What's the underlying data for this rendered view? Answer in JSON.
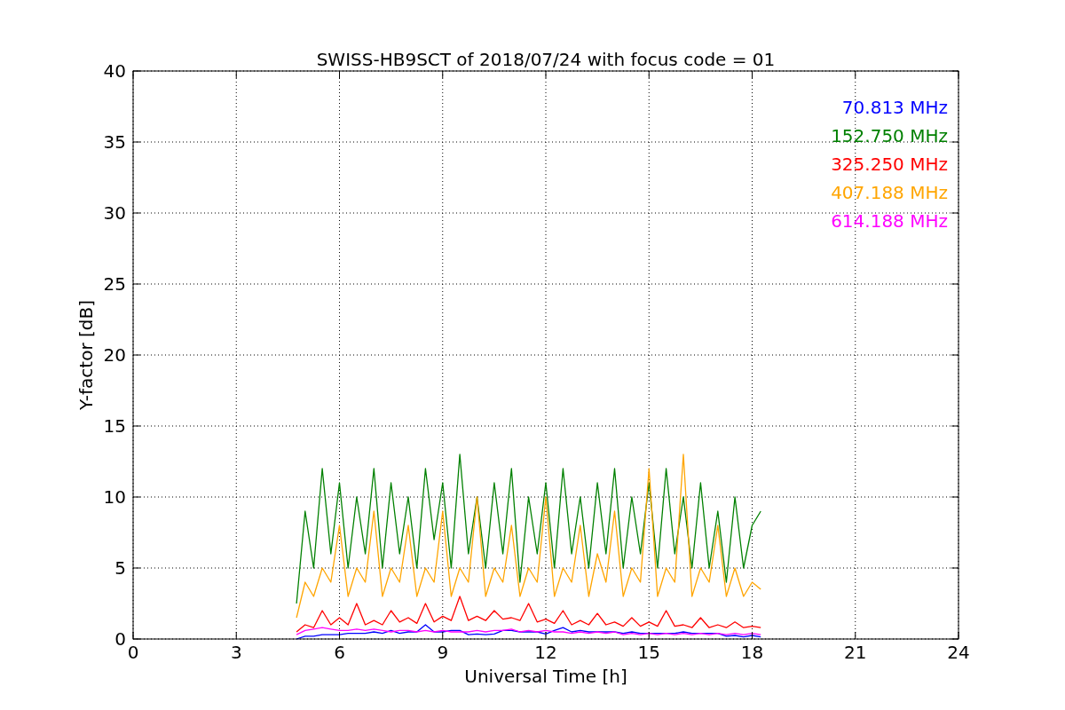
{
  "figure": {
    "chart_data": {
      "type": "line",
      "title": "SWISS-HB9SCT of 2018/07/24 with focus code = 01",
      "xlabel": "Universal Time [h]",
      "ylabel": "Y-factor [dB]",
      "xlim": [
        0,
        24
      ],
      "ylim": [
        0,
        40
      ],
      "grid": true,
      "xticks": [
        0,
        3,
        6,
        9,
        12,
        15,
        18,
        21,
        24
      ],
      "yticks": [
        0,
        5,
        10,
        15,
        20,
        25,
        30,
        35,
        40
      ],
      "x": [
        4.75,
        5,
        5.25,
        5.5,
        5.75,
        6,
        6.25,
        6.5,
        6.75,
        7,
        7.25,
        7.5,
        7.75,
        8,
        8.25,
        8.5,
        8.75,
        9,
        9.25,
        9.5,
        9.75,
        10,
        10.25,
        10.5,
        10.75,
        11,
        11.25,
        11.5,
        11.75,
        12,
        12.25,
        12.5,
        12.75,
        13,
        13.25,
        13.5,
        13.75,
        14,
        14.25,
        14.5,
        14.75,
        15,
        15.25,
        15.5,
        15.75,
        16,
        16.25,
        16.5,
        16.75,
        17,
        17.25,
        17.5,
        17.75,
        18,
        18.25
      ],
      "series": [
        {
          "name": "70.813 MHz",
          "color": "#0000ff",
          "values": [
            0,
            0.2,
            0.2,
            0.3,
            0.3,
            0.3,
            0.4,
            0.4,
            0.4,
            0.5,
            0.4,
            0.6,
            0.4,
            0.5,
            0.5,
            1,
            0.5,
            0.5,
            0.6,
            0.6,
            0.3,
            0.35,
            0.3,
            0.35,
            0.6,
            0.6,
            0.5,
            0.5,
            0.5,
            0.35,
            0.6,
            0.8,
            0.5,
            0.6,
            0.5,
            0.5,
            0.5,
            0.5,
            0.4,
            0.5,
            0.4,
            0.4,
            0.4,
            0.4,
            0.4,
            0.5,
            0.4,
            0.4,
            0.4,
            0.4,
            0.2,
            0.25,
            0.15,
            0.25,
            0.15
          ]
        },
        {
          "name": "152.750 MHz",
          "color": "#008000",
          "values": [
            2.5,
            9,
            5,
            12,
            6,
            11,
            5,
            10,
            6,
            12,
            5,
            11,
            6,
            10,
            5,
            12,
            7,
            11,
            5,
            13,
            6,
            10,
            5,
            11,
            6,
            12,
            4,
            10,
            6,
            11,
            5,
            12,
            6,
            10,
            5,
            11,
            6,
            12,
            5,
            10,
            6,
            11,
            5,
            12,
            6,
            10,
            5,
            11,
            5,
            9,
            4,
            10,
            5,
            8,
            9
          ]
        },
        {
          "name": "325.250 MHz",
          "color": "#ff0000",
          "values": [
            0.5,
            1,
            0.8,
            2,
            1,
            1.5,
            1,
            2.5,
            1,
            1.3,
            1,
            2,
            1.2,
            1.5,
            1.1,
            2.5,
            1.2,
            1.6,
            1.3,
            3,
            1.3,
            1.6,
            1.3,
            2,
            1.4,
            1.5,
            1.3,
            2.5,
            1.2,
            1.4,
            1.1,
            2,
            1,
            1.3,
            1,
            1.8,
            1,
            1.2,
            0.9,
            1.5,
            0.9,
            1.2,
            0.9,
            2,
            0.9,
            1,
            0.8,
            1.5,
            0.8,
            1,
            0.8,
            1.2,
            0.8,
            0.9,
            0.8
          ]
        },
        {
          "name": "407.188 MHz",
          "color": "#ffa500",
          "values": [
            1.5,
            4,
            3,
            5,
            4,
            8,
            3,
            5,
            4,
            9,
            3,
            5,
            4,
            8,
            3,
            5,
            4,
            9,
            3,
            5,
            4,
            10,
            3,
            5,
            4,
            8,
            3,
            5,
            4,
            10,
            3,
            5,
            4,
            8,
            3,
            6,
            4,
            9,
            3,
            5,
            4,
            12,
            3,
            5,
            4,
            13,
            3,
            5,
            4,
            8,
            3,
            5,
            3,
            4,
            3.5
          ]
        },
        {
          "name": "614.188 MHz",
          "color": "#ff00ff",
          "values": [
            0.3,
            0.6,
            0.7,
            0.8,
            0.7,
            0.6,
            0.6,
            0.7,
            0.6,
            0.7,
            0.6,
            0.5,
            0.6,
            0.6,
            0.5,
            0.6,
            0.5,
            0.6,
            0.5,
            0.5,
            0.5,
            0.6,
            0.5,
            0.6,
            0.6,
            0.7,
            0.5,
            0.6,
            0.5,
            0.6,
            0.5,
            0.5,
            0.4,
            0.5,
            0.4,
            0.5,
            0.4,
            0.5,
            0.3,
            0.4,
            0.3,
            0.4,
            0.3,
            0.4,
            0.3,
            0.4,
            0.3,
            0.4,
            0.3,
            0.4,
            0.3,
            0.4,
            0.3,
            0.4,
            0.3
          ]
        }
      ]
    }
  }
}
